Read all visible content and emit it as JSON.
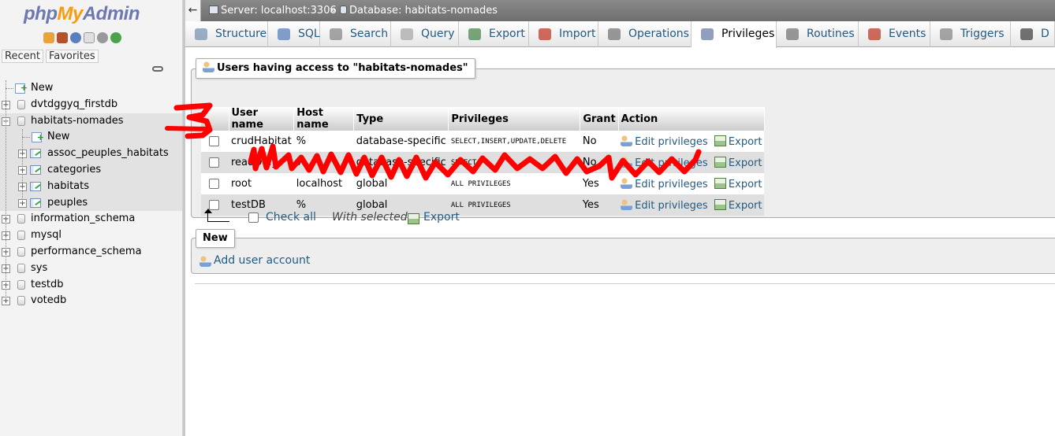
{
  "logo": {
    "part1": "php",
    "part2": "My",
    "part3": "Admin"
  },
  "nav": {
    "icons": [
      "home-icon",
      "exit-icon",
      "help-icon",
      "docs-icon",
      "settings-icon",
      "reload-icon"
    ],
    "recent_label": "Recent",
    "favorites_label": "Favorites",
    "tree": [
      {
        "label": "New",
        "type": "new",
        "level": 0
      },
      {
        "label": "dvtdggyq_firstdb",
        "type": "db",
        "level": 0,
        "expander": "+"
      },
      {
        "label": "habitats-nomades",
        "type": "db",
        "level": 0,
        "expander": "−",
        "selected": true
      },
      {
        "label": "New",
        "type": "new",
        "level": 1,
        "selected": true
      },
      {
        "label": "assoc_peuples_habitats",
        "type": "table",
        "level": 1,
        "expander": "+",
        "selected": true
      },
      {
        "label": "categories",
        "type": "table",
        "level": 1,
        "expander": "+",
        "selected": true
      },
      {
        "label": "habitats",
        "type": "table",
        "level": 1,
        "expander": "+",
        "selected": true
      },
      {
        "label": "peuples",
        "type": "table",
        "level": 1,
        "expander": "+",
        "selected": true
      },
      {
        "label": "information_schema",
        "type": "db",
        "level": 0,
        "expander": "+"
      },
      {
        "label": "mysql",
        "type": "db",
        "level": 0,
        "expander": "+"
      },
      {
        "label": "performance_schema",
        "type": "db",
        "level": 0,
        "expander": "+"
      },
      {
        "label": "sys",
        "type": "db",
        "level": 0,
        "expander": "+"
      },
      {
        "label": "testdb",
        "type": "db",
        "level": 0,
        "expander": "+"
      },
      {
        "label": "votedb",
        "type": "db",
        "level": 0,
        "expander": "+"
      }
    ]
  },
  "topbar": {
    "collapse_glyph": "←",
    "server": "Server: localhost:3306",
    "separator": "»",
    "database": "Database: habitats-nomades"
  },
  "tabs": [
    {
      "label": "Structure",
      "icon": "structure-icon"
    },
    {
      "label": "SQL",
      "icon": "sql-icon"
    },
    {
      "label": "Search",
      "icon": "search-icon"
    },
    {
      "label": "Query",
      "icon": "query-icon"
    },
    {
      "label": "Export",
      "icon": "export-icon"
    },
    {
      "label": "Import",
      "icon": "import-icon"
    },
    {
      "label": "Operations",
      "icon": "wrench-icon"
    },
    {
      "label": "Privileges",
      "icon": "privileges-icon",
      "active": true
    },
    {
      "label": "Routines",
      "icon": "routines-icon"
    },
    {
      "label": "Events",
      "icon": "clock-icon"
    },
    {
      "label": "Triggers",
      "icon": "triggers-icon"
    },
    {
      "label": "D",
      "icon": "designer-icon"
    }
  ],
  "users_panel": {
    "legend": "Users having access to \"habitats-nomades\"",
    "columns": [
      "User name",
      "Host name",
      "Type",
      "Privileges",
      "Grant",
      "Action"
    ],
    "rows": [
      {
        "user": "crudHabitat",
        "host": "%",
        "type": "database-specific",
        "privileges": "SELECT,INSERT,UPDATE,DELETE",
        "grant": "No",
        "edit": "Edit privileges",
        "export": "Export"
      },
      {
        "user": "readOnly",
        "host": "%",
        "type": "database-specific",
        "privileges": "SELECT",
        "grant": "No",
        "edit": "Edit privileges",
        "export": "Export"
      },
      {
        "user": "root",
        "host": "localhost",
        "type": "global",
        "privileges": "ALL PRIVILEGES",
        "grant": "Yes",
        "edit": "Edit privileges",
        "export": "Export"
      },
      {
        "user": "testDB",
        "host": "%",
        "type": "global",
        "privileges": "ALL PRIVILEGES",
        "grant": "Yes",
        "edit": "Edit privileges",
        "export": "Export"
      }
    ],
    "check_all": "Check all",
    "with_selected": "With selected:",
    "export_selected": "Export"
  },
  "new_panel": {
    "legend": "New",
    "add_user": "Add user account"
  },
  "colors": {
    "link": "#235a81",
    "scribble": "#ff0000",
    "logo_blue": "#6c78af",
    "logo_orange": "#f89c0e"
  }
}
